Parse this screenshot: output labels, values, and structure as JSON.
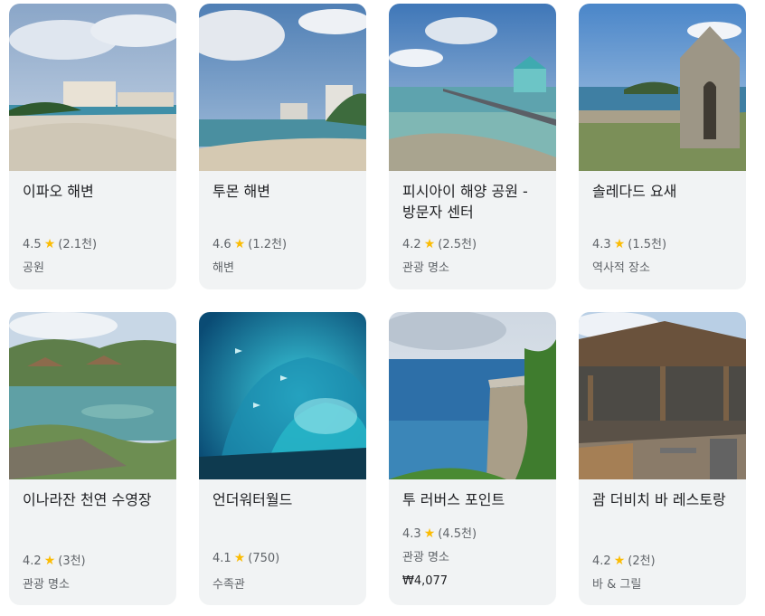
{
  "places": [
    {
      "name": "이파오 해변",
      "rating": "4.5",
      "reviews": "(2.1천)",
      "category": "공원"
    },
    {
      "name": "투몬 해변",
      "rating": "4.6",
      "reviews": "(1.2천)",
      "category": "해변"
    },
    {
      "name": "피시아이 해양 공원 - 방문자 센터",
      "rating": "4.2",
      "reviews": "(2.5천)",
      "category": "관광 명소"
    },
    {
      "name": "솔레다드 요새",
      "rating": "4.3",
      "reviews": "(1.5천)",
      "category": "역사적 장소"
    },
    {
      "name": "이나라잔 천연 수영장",
      "rating": "4.2",
      "reviews": "(3천)",
      "category": "관광 명소"
    },
    {
      "name": "언더워터월드",
      "rating": "4.1",
      "reviews": "(750)",
      "category": "수족관"
    },
    {
      "name": "투 러버스 포인트",
      "rating": "4.3",
      "reviews": "(4.5천)",
      "category": "관광 명소",
      "price": "₩4,077"
    },
    {
      "name": "괌 더비치 바 레스토랑",
      "rating": "4.2",
      "reviews": "(2천)",
      "category": "바 & 그릴"
    }
  ],
  "icons": {
    "star": "star-icon"
  },
  "colors": {
    "card_bg": "#f1f3f4",
    "star": "#fbbc04",
    "text_primary": "#202124",
    "text_secondary": "#5f6368"
  }
}
